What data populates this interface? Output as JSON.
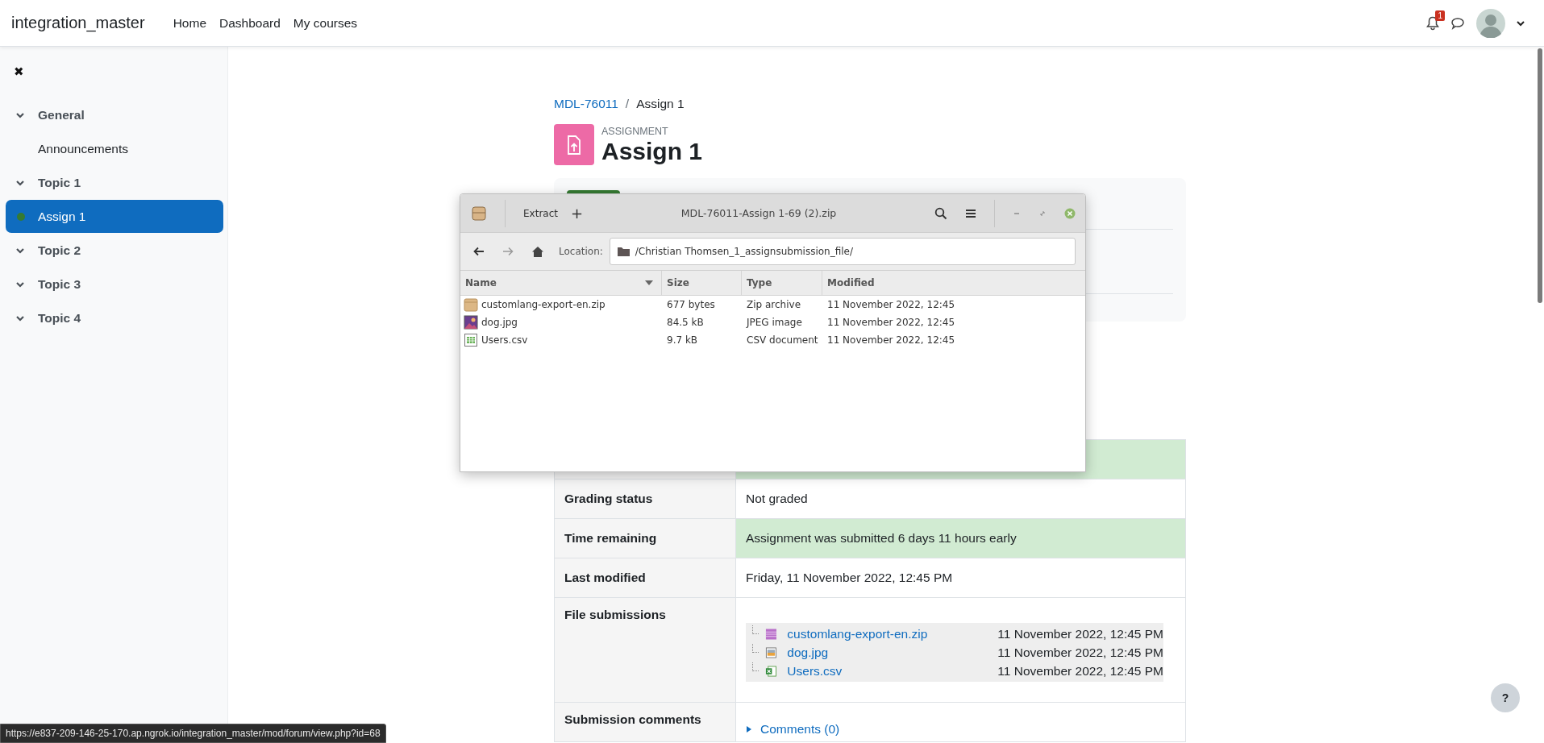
{
  "navbar": {
    "brand": "integration_master",
    "links": [
      "Home",
      "Dashboard",
      "My courses"
    ],
    "notification_count": "1"
  },
  "sidebar": {
    "close": "✖",
    "items": [
      {
        "kind": "section",
        "label": "General",
        "expanded": true,
        "selected": false
      },
      {
        "kind": "activity",
        "label": "Announcements",
        "completed": false,
        "selected": false
      },
      {
        "kind": "section",
        "label": "Topic 1",
        "expanded": true,
        "selected": false
      },
      {
        "kind": "activity",
        "label": "Assign 1",
        "completed": true,
        "selected": true
      },
      {
        "kind": "section",
        "label": "Topic 2",
        "expanded": true,
        "selected": false
      },
      {
        "kind": "section",
        "label": "Topic 3",
        "expanded": true,
        "selected": false
      },
      {
        "kind": "section",
        "label": "Topic 4",
        "expanded": true,
        "selected": false
      }
    ]
  },
  "breadcrumb": {
    "separator": "/",
    "items": [
      {
        "label": "MDL-76011",
        "link": true
      },
      {
        "label": "Assign 1",
        "link": false
      }
    ]
  },
  "header": {
    "type_label": "ASSIGNMENT",
    "title": "Assign 1"
  },
  "submission_table": {
    "rows": [
      {
        "kind": "text",
        "highlight": true
      },
      {
        "kind": "text",
        "label": "Grading status",
        "value": "Not graded",
        "highlight": false
      },
      {
        "kind": "text",
        "label": "Time remaining",
        "value": "Assignment was submitted 6 days 11 hours early",
        "highlight": true
      },
      {
        "kind": "text",
        "label": "Last modified",
        "value": "Friday, 11 November 2022, 12:45 PM",
        "highlight": false
      },
      {
        "kind": "files",
        "label": "File submissions",
        "highlight": false,
        "files": [
          {
            "name": "customlang-export-en.zip",
            "date": "11 November 2022, 12:45 PM",
            "kind": "archive"
          },
          {
            "name": "dog.jpg",
            "date": "11 November 2022, 12:45 PM",
            "kind": "image"
          },
          {
            "name": "Users.csv",
            "date": "11 November 2022, 12:45 PM",
            "kind": "spreadsheet"
          }
        ]
      },
      {
        "kind": "comments",
        "label": "Submission comments",
        "link": "Comments (0)",
        "highlight": false
      }
    ]
  },
  "archive_window": {
    "title": "MDL-76011-Assign 1-69 (2).zip",
    "extract_label": "Extract",
    "add_label": "+",
    "location_label": "Location:",
    "location": "/Christian Thomsen_1_assignsubmission_file/",
    "columns": [
      "Name",
      "Size",
      "Type",
      "Modified"
    ],
    "files": [
      {
        "name": "customlang-export-en.zip",
        "size": "677 bytes",
        "type": "Zip archive",
        "modified": "11 November 2022, 12:45",
        "kind": "archive"
      },
      {
        "name": "dog.jpg",
        "size": "84.5 kB",
        "type": "JPEG image",
        "modified": "11 November 2022, 12:45",
        "kind": "image"
      },
      {
        "name": "Users.csv",
        "size": "9.7 kB",
        "type": "CSV document",
        "modified": "11 November 2022, 12:45",
        "kind": "spreadsheet"
      }
    ]
  },
  "status_url": "https://e837-209-146-25-170.ap.ngrok.io/integration_master/mod/forum/view.php?id=68",
  "help_label": "?"
}
